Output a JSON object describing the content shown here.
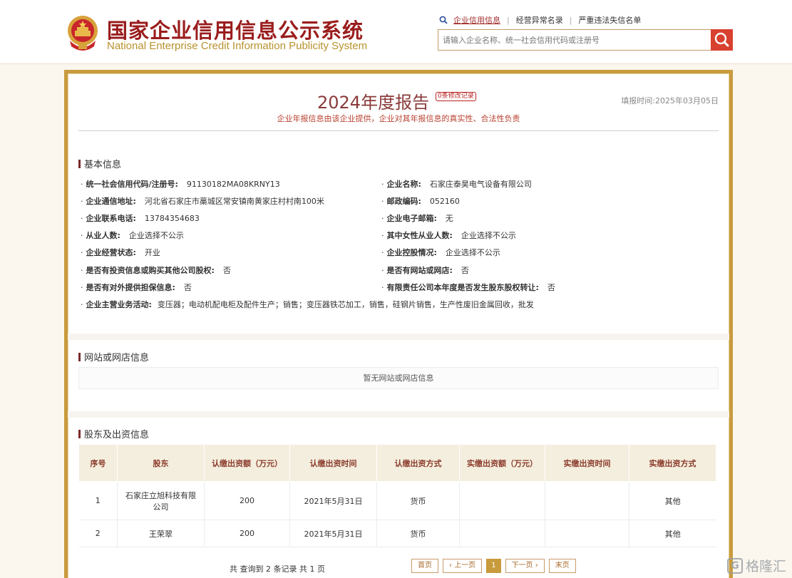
{
  "header": {
    "title_cn": "国家企业信用信息公示系统",
    "title_en": "National Enterprise Credit Information Publicity System",
    "nav": [
      "企业信用信息",
      "经营异常名录",
      "严重违法失信名单"
    ],
    "search_placeholder": "请输入企业名称、统一社会信用代码或注册号"
  },
  "report": {
    "title": "2024年度报告",
    "mod_badge": "0条修改记录",
    "fill_time": "填报时间:2025年03月05日",
    "subtitle": "企业年报信息由该企业提供，企业对其年报信息的真实性、合法性负责"
  },
  "basic": {
    "heading": "基本信息",
    "fields": [
      {
        "label": "统一社会信用代码/注册号:",
        "value": "91130182MA08KRNY13"
      },
      {
        "label": "企业名称:",
        "value": "石家庄泰昊电气设备有限公司"
      },
      {
        "label": "企业通信地址:",
        "value": "河北省石家庄市藁城区常安镇南黄家庄村村南100米"
      },
      {
        "label": "邮政编码:",
        "value": "052160"
      },
      {
        "label": "企业联系电话:",
        "value": "13784354683"
      },
      {
        "label": "企业电子邮箱:",
        "value": "无"
      },
      {
        "label": "从业人数:",
        "value": "企业选择不公示"
      },
      {
        "label": "其中女性从业人数:",
        "value": "企业选择不公示"
      },
      {
        "label": "企业经营状态:",
        "value": "开业"
      },
      {
        "label": "企业控股情况:",
        "value": "企业选择不公示"
      },
      {
        "label": "是否有投资信息或购买其他公司股权:",
        "value": "否"
      },
      {
        "label": "是否有网站或网店:",
        "value": "否"
      },
      {
        "label": "是否有对外提供担保信息:",
        "value": "否"
      },
      {
        "label": "有限责任公司本年度是否发生股东股权转让:",
        "value": "否"
      },
      {
        "label": "企业主营业务活动:",
        "value": "变压器；电动机配电柜及配件生产；销售；变压器铁芯加工，销售，硅钢片销售，生产性废旧金属回收，批发"
      }
    ]
  },
  "website": {
    "heading": "网站或网店信息",
    "empty_text": "暂无网站或网店信息"
  },
  "shareholders": {
    "heading": "股东及出资信息",
    "columns": [
      "序号",
      "股东",
      "认缴出资额（万元）",
      "认缴出资时间",
      "认缴出资方式",
      "实缴出资额（万元）",
      "实缴出资时间",
      "实缴出资方式"
    ],
    "rows": [
      [
        "1",
        "石家庄立旭科技有限公司",
        "200",
        "2021年5月31日",
        "货币",
        "",
        "",
        "其他"
      ],
      [
        "2",
        "王荣翠",
        "200",
        "2021年5月31日",
        "货币",
        "",
        "",
        "其他"
      ]
    ]
  },
  "pager": {
    "info": "共 查询到 2 条记录 共 1 页",
    "first": "首页",
    "prev": "上一页",
    "current": "1",
    "next": "下一页",
    "last": "末页"
  },
  "watermark": {
    "text": "格隆汇"
  }
}
